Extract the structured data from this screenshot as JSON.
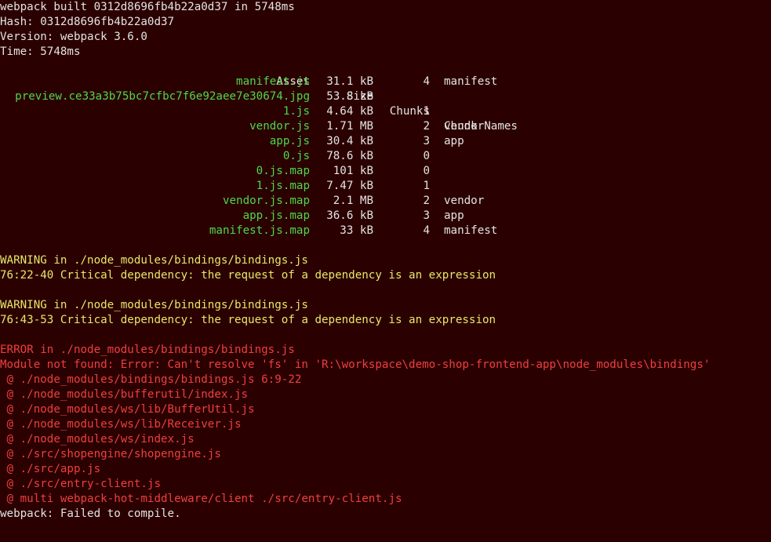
{
  "colors": {
    "background": "#2b0000",
    "text": "#e4e4e4",
    "asset_green": "#4fd64f",
    "warning_yellow": "#e8e86a",
    "error_red": "#ef3f3f"
  },
  "header": {
    "built": "webpack built 0312d8696fb4b22a0d37 in 5748ms",
    "hash": "Hash: 0312d8696fb4b22a0d37",
    "version": "Version: webpack 3.6.0",
    "time": "Time: 5748ms"
  },
  "table": {
    "columns": [
      "Asset",
      "Size",
      "Chunks",
      "Chunk Names"
    ],
    "rows": [
      {
        "asset": "manifest.js",
        "size": "31.1 kB",
        "chunks": "4",
        "names": "manifest"
      },
      {
        "asset": "preview.ce33a3b75bc7cfbc7f6e92aee7e30674.jpg",
        "size": "53.8 kB",
        "chunks": "",
        "names": ""
      },
      {
        "asset": "1.js",
        "size": "4.64 kB",
        "chunks": "1",
        "names": ""
      },
      {
        "asset": "vendor.js",
        "size": "1.71 MB",
        "chunks": "2",
        "names": "vendor"
      },
      {
        "asset": "app.js",
        "size": "30.4 kB",
        "chunks": "3",
        "names": "app"
      },
      {
        "asset": "0.js",
        "size": "78.6 kB",
        "chunks": "0",
        "names": ""
      },
      {
        "asset": "0.js.map",
        "size": "101 kB",
        "chunks": "0",
        "names": ""
      },
      {
        "asset": "1.js.map",
        "size": "7.47 kB",
        "chunks": "1",
        "names": ""
      },
      {
        "asset": "vendor.js.map",
        "size": "2.1 MB",
        "chunks": "2",
        "names": "vendor"
      },
      {
        "asset": "app.js.map",
        "size": "36.6 kB",
        "chunks": "3",
        "names": "app"
      },
      {
        "asset": "manifest.js.map",
        "size": "33 kB",
        "chunks": "4",
        "names": "manifest"
      }
    ]
  },
  "warnings": [
    {
      "title": "WARNING in ./node_modules/bindings/bindings.js",
      "detail": "76:22-40 Critical dependency: the request of a dependency is an expression"
    },
    {
      "title": "WARNING in ./node_modules/bindings/bindings.js",
      "detail": "76:43-53 Critical dependency: the request of a dependency is an expression"
    }
  ],
  "error": {
    "title": "ERROR in ./node_modules/bindings/bindings.js",
    "message": "Module not found: Error: Can't resolve 'fs' in 'R:\\workspace\\demo-shop-frontend-app\\node_modules\\bindings'",
    "trace": [
      " @ ./node_modules/bindings/bindings.js 6:9-22",
      " @ ./node_modules/bufferutil/index.js",
      " @ ./node_modules/ws/lib/BufferUtil.js",
      " @ ./node_modules/ws/lib/Receiver.js",
      " @ ./node_modules/ws/index.js",
      " @ ./src/shopengine/shopengine.js",
      " @ ./src/app.js",
      " @ ./src/entry-client.js",
      " @ multi webpack-hot-middleware/client ./src/entry-client.js"
    ]
  },
  "footer": "webpack: Failed to compile."
}
